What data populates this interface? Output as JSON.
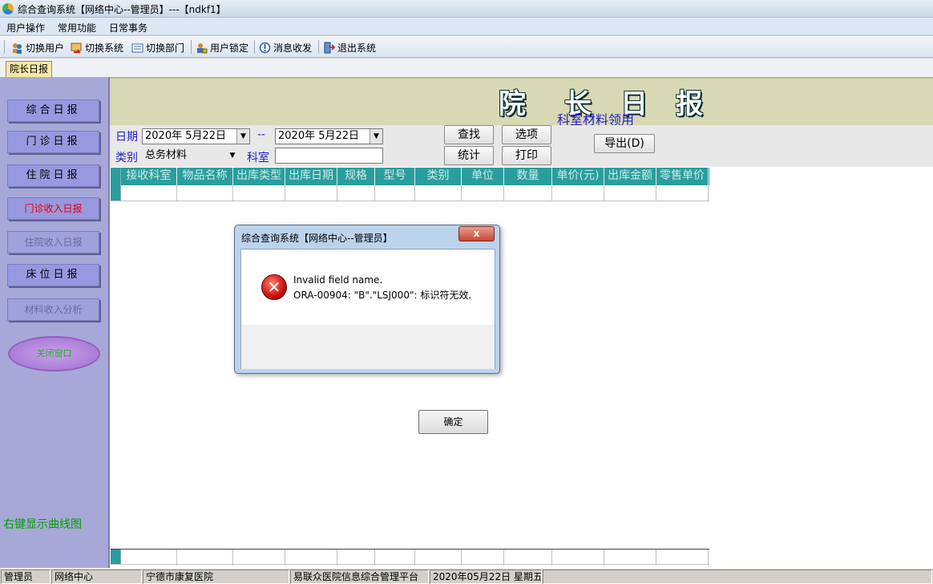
{
  "window": {
    "title": "综合查询系统【网络中心--管理员】---【ndkf1】"
  },
  "menu": [
    "用户操作",
    "常用功能",
    "日常事务"
  ],
  "toolbar": [
    {
      "label": "切换用户",
      "icon": "users-icon"
    },
    {
      "label": "切换系统",
      "icon": "switch-system-icon"
    },
    {
      "label": "切换部门",
      "icon": "department-icon"
    },
    {
      "label": "用户锁定",
      "icon": "lock-user-icon"
    },
    {
      "label": "消息收发",
      "icon": "message-icon"
    },
    {
      "label": "退出系统",
      "icon": "exit-icon"
    }
  ],
  "tabs": [
    "院长日报"
  ],
  "sidebar": {
    "buttons": [
      "综合日报",
      "门诊日报",
      "住院日报",
      "门诊收入日报",
      "住院收入日报",
      "床位日报",
      "材料收入分析"
    ],
    "close_label": "关闭窗口",
    "hint": "右键显示曲线图"
  },
  "report": {
    "title_chars": [
      "院",
      "长",
      "日",
      "报"
    ],
    "subtitle": "科室材料领用"
  },
  "filters": {
    "date_label": "日期",
    "date_from": "2020年  5月22日",
    "separator": "--",
    "date_to": "2020年  5月22日",
    "category_label": "类别",
    "category_value": "总务材料",
    "dept_label": "科室",
    "dept_value": ""
  },
  "actions": {
    "search": "查找",
    "options": "选项",
    "stats": "统计",
    "print": "打印",
    "export": "导出(D)"
  },
  "grid": {
    "columns": [
      "接收科室",
      "物品名称",
      "出库类型",
      "出库日期",
      "规格",
      "型号",
      "类别",
      "单位",
      "数量",
      "单价(元)",
      "出库金额",
      "零售单价"
    ]
  },
  "dialog": {
    "title": "综合查询系统【网络中心--管理员】",
    "close": "x",
    "message_line1": "Invalid field name.",
    "message_line2": "ORA-00904: \"B\".\"LSJ000\": 标识符无效.",
    "ok": "确定"
  },
  "statusbar": [
    "管理员",
    "网络中心",
    "宁德市康复医院",
    "易联众医院信息综合管理平台",
    "2020年05月22日  星期五"
  ]
}
